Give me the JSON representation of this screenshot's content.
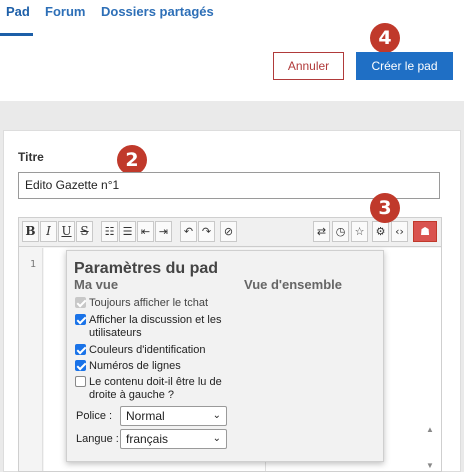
{
  "tabs": [
    {
      "label": "Pad",
      "active": true
    },
    {
      "label": "Forum",
      "active": false
    },
    {
      "label": "Dossiers partagés",
      "active": false
    }
  ],
  "badges": {
    "b2": "2",
    "b3": "3",
    "b4": "4"
  },
  "actions": {
    "cancel_label": "Annuler",
    "create_label": "Créer le pad"
  },
  "form": {
    "title_label": "Titre",
    "title_value": "Edito Gazette n°1"
  },
  "toolbar": {
    "buttons_left": [
      "bold-icon",
      "italic-icon",
      "underline-icon",
      "strikethrough-icon",
      "ordered-list-icon",
      "bullet-list-icon",
      "outdent-icon",
      "indent-icon",
      "undo-icon",
      "redo-icon",
      "clear-format-icon"
    ],
    "buttons_right": [
      "import-export-icon",
      "history-icon",
      "star-icon",
      "gear-icon",
      "embed-icon",
      "users-icon"
    ]
  },
  "editor": {
    "line_number": "1"
  },
  "settings_popup": {
    "title": "Paramètres du pad",
    "col_my_view": "Ma vue",
    "col_overview": "Vue d'ensemble",
    "options": [
      {
        "label": "Toujours afficher le tchat",
        "checked": true,
        "disabled": true
      },
      {
        "label": "Afficher la discussion et les utilisateurs",
        "checked": true,
        "disabled": false
      },
      {
        "label": "Couleurs d'identification",
        "checked": true,
        "disabled": false
      },
      {
        "label": "Numéros de lignes",
        "checked": true,
        "disabled": false
      },
      {
        "label": "Le contenu doit-il être lu de droite à gauche ?",
        "checked": false,
        "disabled": false
      }
    ],
    "font_label": "Police :",
    "font_value": "Normal",
    "language_label": "Langue :",
    "language_value": "français"
  },
  "colors": {
    "accent": "#1f6fc5",
    "danger": "#b03a3a",
    "badge": "#c0392b"
  }
}
